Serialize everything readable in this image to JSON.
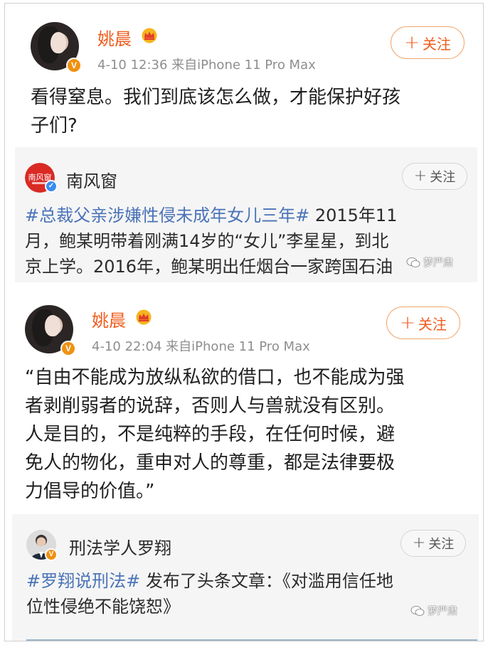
{
  "posts": [
    {
      "username": "姚晨",
      "meta": "4-10 12:36  来自iPhone 11 Pro Max",
      "follow_label": "关注",
      "text_lines": [
        "看得窒息。我们到底该怎么做，才能保护好孩",
        "子们?"
      ],
      "repost": {
        "author": "南风窗",
        "follow_label": "关注",
        "hashtag": "#总裁父亲涉嫌性侵未成年女儿三年#",
        "line1_rest": " 2015年11",
        "line2": "月，鲍某明带着刚满14岁的“女儿”李星星，到北",
        "line3": "京上学。2016年，鲍某明出任烟台一家跨国石油"
      }
    },
    {
      "username": "姚晨",
      "meta": "4-10 22:04  来自iPhone 11 Pro Max",
      "follow_label": "关注",
      "text_lines": [
        "“自由不能成为放纵私欲的借口，也不能成为强",
        "者剥削弱者的说辞，否则人与兽就没有区别。",
        "人是目的，不是纯粹的手段，在任何时候，避",
        "免人的物化，重申对人的尊重，都是法律要极",
        "力倡导的价值。”"
      ],
      "repost": {
        "author": "刑法学人罗翔",
        "follow_label": "关注",
        "hashtag": "#罗翔说刑法#",
        "line1_rest": " 发布了头条文章：《对滥用信任地",
        "line2": "位性侵绝不能饶恕》"
      }
    }
  ],
  "watermark": "萝严肃",
  "colors": {
    "username": "#f05b1b",
    "hashtag": "#4a73b8",
    "badge": "#f09112"
  }
}
